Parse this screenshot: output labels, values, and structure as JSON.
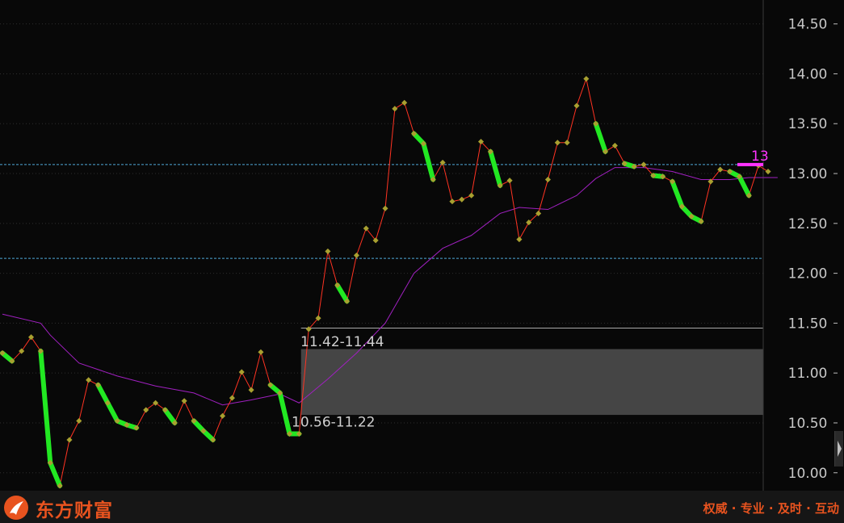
{
  "chart_data": {
    "type": "line",
    "y_axis": {
      "ylim": [
        9.82,
        14.74
      ],
      "ticks": [
        "14.50",
        "14.00",
        "13.50",
        "13.00",
        "12.50",
        "12.00",
        "11.50",
        "11.00",
        "10.50",
        "10.00"
      ],
      "tick_values": [
        14.5,
        14.0,
        13.5,
        13.0,
        12.5,
        12.0,
        11.5,
        11.0,
        10.5,
        10.0
      ]
    },
    "price_series": [
      {
        "t": 0,
        "y": 11.2
      },
      {
        "t": 1,
        "y": 11.12
      },
      {
        "t": 2,
        "y": 11.22
      },
      {
        "t": 3,
        "y": 11.36
      },
      {
        "t": 4,
        "y": 11.22
      },
      {
        "t": 5,
        "y": 10.1
      },
      {
        "t": 6,
        "y": 9.87
      },
      {
        "t": 7,
        "y": 10.33
      },
      {
        "t": 8,
        "y": 10.52
      },
      {
        "t": 9,
        "y": 10.93
      },
      {
        "t": 10,
        "y": 10.88
      },
      {
        "t": 11,
        "y": 10.7
      },
      {
        "t": 12,
        "y": 10.52
      },
      {
        "t": 13,
        "y": 10.48
      },
      {
        "t": 14,
        "y": 10.45
      },
      {
        "t": 15,
        "y": 10.63
      },
      {
        "t": 16,
        "y": 10.7
      },
      {
        "t": 17,
        "y": 10.63
      },
      {
        "t": 18,
        "y": 10.5
      },
      {
        "t": 19,
        "y": 10.72
      },
      {
        "t": 20,
        "y": 10.52
      },
      {
        "t": 21,
        "y": 10.42
      },
      {
        "t": 22,
        "y": 10.33
      },
      {
        "t": 23,
        "y": 10.57
      },
      {
        "t": 24,
        "y": 10.75
      },
      {
        "t": 25,
        "y": 11.01
      },
      {
        "t": 26,
        "y": 10.83
      },
      {
        "t": 27,
        "y": 11.21
      },
      {
        "t": 28,
        "y": 10.88
      },
      {
        "t": 29,
        "y": 10.8
      },
      {
        "t": 30,
        "y": 10.39
      },
      {
        "t": 31,
        "y": 10.39
      },
      {
        "t": 32,
        "y": 11.44
      },
      {
        "t": 33,
        "y": 11.55
      },
      {
        "t": 34,
        "y": 12.22
      },
      {
        "t": 35,
        "y": 11.88
      },
      {
        "t": 36,
        "y": 11.72
      },
      {
        "t": 37,
        "y": 12.18
      },
      {
        "t": 38,
        "y": 12.45
      },
      {
        "t": 39,
        "y": 12.33
      },
      {
        "t": 40,
        "y": 12.65
      },
      {
        "t": 41,
        "y": 13.65
      },
      {
        "t": 42,
        "y": 13.71
      },
      {
        "t": 43,
        "y": 13.4
      },
      {
        "t": 44,
        "y": 13.3
      },
      {
        "t": 45,
        "y": 12.94
      },
      {
        "t": 46,
        "y": 13.11
      },
      {
        "t": 47,
        "y": 12.72
      },
      {
        "t": 48,
        "y": 12.74
      },
      {
        "t": 49,
        "y": 12.78
      },
      {
        "t": 50,
        "y": 13.32
      },
      {
        "t": 51,
        "y": 13.22
      },
      {
        "t": 52,
        "y": 12.88
      },
      {
        "t": 53,
        "y": 12.93
      },
      {
        "t": 54,
        "y": 12.34
      },
      {
        "t": 55,
        "y": 12.51
      },
      {
        "t": 56,
        "y": 12.6
      },
      {
        "t": 57,
        "y": 12.94
      },
      {
        "t": 58,
        "y": 13.31
      },
      {
        "t": 59,
        "y": 13.31
      },
      {
        "t": 60,
        "y": 13.68
      },
      {
        "t": 61,
        "y": 13.95
      },
      {
        "t": 62,
        "y": 13.5
      },
      {
        "t": 63,
        "y": 13.22
      },
      {
        "t": 64,
        "y": 13.28
      },
      {
        "t": 65,
        "y": 13.1
      },
      {
        "t": 66,
        "y": 13.07
      },
      {
        "t": 67,
        "y": 13.09
      },
      {
        "t": 68,
        "y": 12.98
      },
      {
        "t": 69,
        "y": 12.97
      },
      {
        "t": 70,
        "y": 12.92
      },
      {
        "t": 71,
        "y": 12.67
      },
      {
        "t": 72,
        "y": 12.57
      },
      {
        "t": 73,
        "y": 12.52
      },
      {
        "t": 74,
        "y": 12.92
      },
      {
        "t": 75,
        "y": 13.04
      },
      {
        "t": 76,
        "y": 13.02
      },
      {
        "t": 77,
        "y": 12.97
      },
      {
        "t": 78,
        "y": 12.78
      },
      {
        "t": 79,
        "y": 13.08
      },
      {
        "t": 80,
        "y": 13.02
      }
    ],
    "down_segments": [
      [
        0,
        1
      ],
      [
        4,
        5
      ],
      [
        5,
        6
      ],
      [
        10,
        11
      ],
      [
        11,
        12
      ],
      [
        12,
        13
      ],
      [
        13,
        14
      ],
      [
        17,
        18
      ],
      [
        20,
        21
      ],
      [
        21,
        22
      ],
      [
        28,
        29
      ],
      [
        29,
        30
      ],
      [
        30,
        31
      ],
      [
        35,
        36
      ],
      [
        43,
        44
      ],
      [
        44,
        45
      ],
      [
        51,
        52
      ],
      [
        62,
        63
      ],
      [
        65,
        66
      ],
      [
        68,
        69
      ],
      [
        70,
        71
      ],
      [
        71,
        72
      ],
      [
        72,
        73
      ],
      [
        76,
        77
      ],
      [
        77,
        78
      ]
    ],
    "ma_series": [
      {
        "t": 0,
        "y": 11.59
      },
      {
        "t": 4,
        "y": 11.5
      },
      {
        "t": 5,
        "y": 11.38
      },
      {
        "t": 8,
        "y": 11.1
      },
      {
        "t": 12,
        "y": 10.97
      },
      {
        "t": 16,
        "y": 10.87
      },
      {
        "t": 20,
        "y": 10.8
      },
      {
        "t": 23,
        "y": 10.68
      },
      {
        "t": 26,
        "y": 10.73
      },
      {
        "t": 29,
        "y": 10.79
      },
      {
        "t": 31,
        "y": 10.7
      },
      {
        "t": 34,
        "y": 10.94
      },
      {
        "t": 37,
        "y": 11.2
      },
      {
        "t": 40,
        "y": 11.5
      },
      {
        "t": 43,
        "y": 12.0
      },
      {
        "t": 46,
        "y": 12.25
      },
      {
        "t": 49,
        "y": 12.38
      },
      {
        "t": 52,
        "y": 12.6
      },
      {
        "t": 54,
        "y": 12.66
      },
      {
        "t": 57,
        "y": 12.64
      },
      {
        "t": 60,
        "y": 12.78
      },
      {
        "t": 62,
        "y": 12.95
      },
      {
        "t": 64,
        "y": 13.06
      },
      {
        "t": 67,
        "y": 13.06
      },
      {
        "t": 70,
        "y": 13.02
      },
      {
        "t": 73,
        "y": 12.94
      },
      {
        "t": 76,
        "y": 12.94
      },
      {
        "t": 78,
        "y": 12.96
      },
      {
        "t": 81,
        "y": 12.96
      }
    ],
    "reference_lines": [
      {
        "y": 13.09,
        "style": "dashed",
        "color": "#4fa8d8"
      },
      {
        "y": 12.15,
        "style": "dashed",
        "color": "#4fa8d8"
      },
      {
        "y": 11.45,
        "style": "solid",
        "color": "#bfbfbf"
      }
    ],
    "price_zone": {
      "y_low": 10.58,
      "y_high": 11.24,
      "t_start": 31.2,
      "color": "#454545"
    },
    "annotations": {
      "upper_zone_label": "11.42-11.44",
      "lower_zone_label": "10.56-11.22",
      "last_price_label": "13"
    },
    "colors": {
      "background": "#080808",
      "price_line": "#ff3322",
      "down_highlight": "#22e822",
      "ma_line": "#a020c0",
      "marker": "#a8a030",
      "grid": "#2e2e2e",
      "axis_text": "#c8c8c8",
      "last_price": "#ff33ff"
    }
  },
  "footer": {
    "logo_text": "东方财富",
    "slogan": "权威 · 专业 · 及时 · 互动"
  }
}
